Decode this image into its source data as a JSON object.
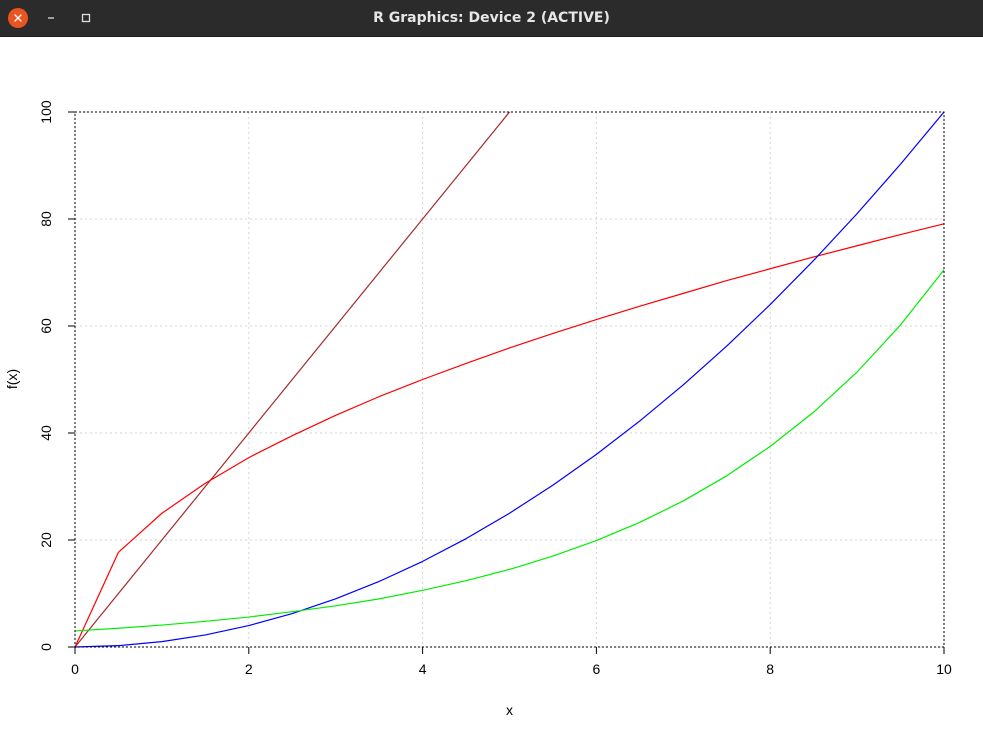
{
  "window": {
    "title": "R Graphics: Device 2 (ACTIVE)",
    "controls": [
      "close-icon",
      "minimize-icon",
      "maximize-icon"
    ]
  },
  "chart_data": {
    "type": "line",
    "title": "",
    "xlabel": "x",
    "ylabel": "f(x)",
    "xlim": [
      0,
      10
    ],
    "ylim": [
      0,
      100
    ],
    "x_ticks": [
      "0",
      "2",
      "4",
      "6",
      "8",
      "10"
    ],
    "y_ticks": [
      "0",
      "20",
      "40",
      "60",
      "80",
      "100"
    ],
    "grid": true,
    "legend": "none",
    "x": [
      0,
      0.5,
      1,
      1.5,
      2,
      2.5,
      3,
      3.5,
      4,
      4.5,
      5,
      5.5,
      6,
      6.5,
      7,
      7.5,
      8,
      8.5,
      9,
      9.5,
      10
    ],
    "series": [
      {
        "color": "#a52a2a",
        "values": [
          0,
          10,
          20,
          30,
          40,
          50,
          60,
          70,
          80,
          90,
          100,
          null,
          null,
          null,
          null,
          null,
          null,
          null,
          null,
          null,
          null
        ]
      },
      {
        "color": "#ff0000",
        "values": [
          0,
          17.7,
          25.0,
          30.6,
          35.4,
          39.5,
          43.3,
          46.8,
          50.0,
          53.0,
          55.9,
          58.6,
          61.2,
          63.7,
          66.1,
          68.5,
          70.7,
          72.9,
          75.0,
          77.1,
          79.1
        ]
      },
      {
        "color": "#0000ff",
        "values": [
          0,
          0.25,
          1,
          2.25,
          4,
          6.25,
          9,
          12.25,
          16,
          20.25,
          25,
          30.25,
          36,
          42.25,
          49,
          56.25,
          64,
          72.25,
          81,
          90.25,
          100
        ]
      },
      {
        "color": "#00ee00",
        "values": [
          3.0,
          3.5,
          4.1,
          4.8,
          5.6,
          6.6,
          7.7,
          9.0,
          10.6,
          12.4,
          14.5,
          17.0,
          19.9,
          23.3,
          27.3,
          32.0,
          37.5,
          43.9,
          51.4,
          60.2,
          70.5
        ]
      }
    ]
  }
}
